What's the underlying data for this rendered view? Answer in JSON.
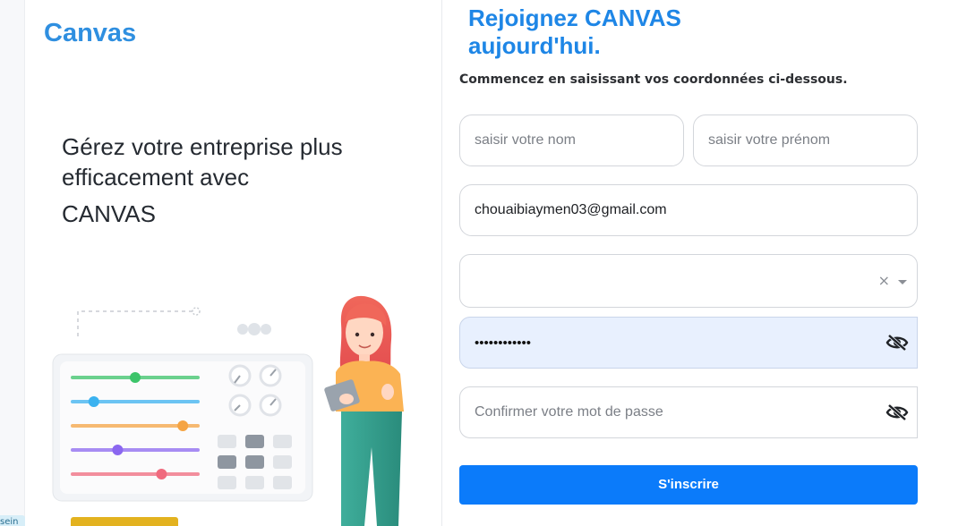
{
  "app": {
    "brand": "Canvas",
    "edge_badge": "sein"
  },
  "hero": {
    "line1": "Gérez votre entreprise plus",
    "line2": "efficacement avec",
    "line3": "CANVAS"
  },
  "form": {
    "heading_line1": "Rejoignez CANVAS",
    "heading_line2": "aujourd'hui.",
    "subtitle": "Commencez en saisissant vos coordonnées ci-dessous.",
    "nom_placeholder": "saisir votre nom",
    "prenom_placeholder": "saisir votre prénom",
    "email_value": "chouaibiaymen03@gmail.com",
    "select_value": "",
    "select_clear": "×",
    "password_masked": "••••••••••••",
    "confirm_placeholder": "Confirmer votre mot de passe",
    "submit_label": "S'inscrire"
  },
  "icons": {
    "password_toggle": "eye-off-icon",
    "confirm_toggle": "eye-off-icon",
    "select_caret": "chevron-down-icon",
    "select_clear": "close-icon"
  },
  "colors": {
    "brand": "#2f8fe0",
    "heading": "#1e86e6",
    "button": "#0b7bfa",
    "autofill": "#e8f0fe",
    "slider_colors": [
      "#3cc46a",
      "#3bb2f0",
      "#f5a443",
      "#8b67f0",
      "#f06a7e"
    ]
  },
  "illustration": {
    "slider_levels": [
      0.5,
      0.17,
      0.88,
      0.36,
      0.71
    ]
  }
}
